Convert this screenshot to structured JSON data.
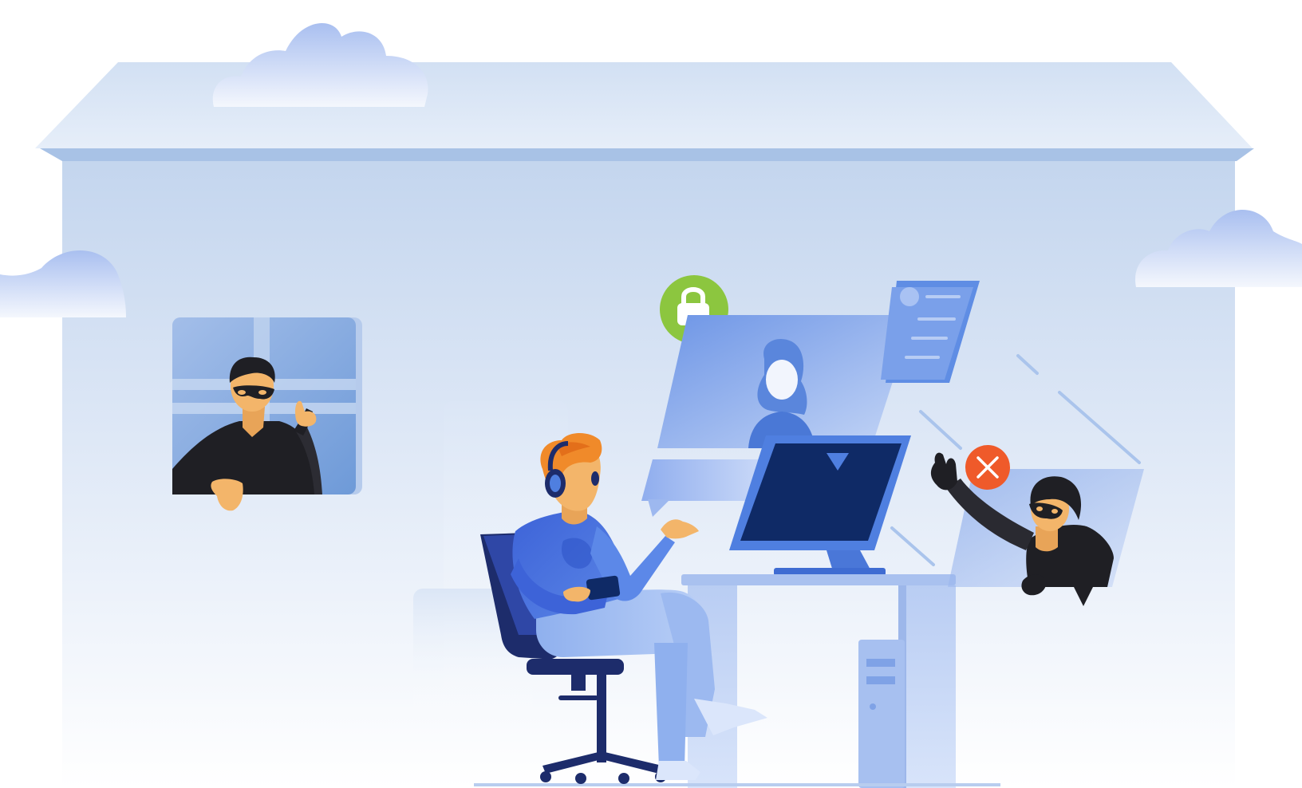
{
  "illustration": {
    "theme": "secure video call while hackers try to intrude",
    "colors": {
      "sky_light": "#e6eef9",
      "building_top": "#c8d8ef",
      "building_fade": "#ffffff",
      "primary_blue": "#4f7fe0",
      "navy": "#1d2c6b",
      "lock_badge": "#8cc63f",
      "blocked_badge": "#ef5a2a",
      "skin": "#f3b56a",
      "hair_orange": "#f08a2a",
      "hacker_black": "#1f1f24"
    },
    "icons": {
      "lock_badge": "lock-icon",
      "blocked_badge": "x-icon"
    }
  }
}
